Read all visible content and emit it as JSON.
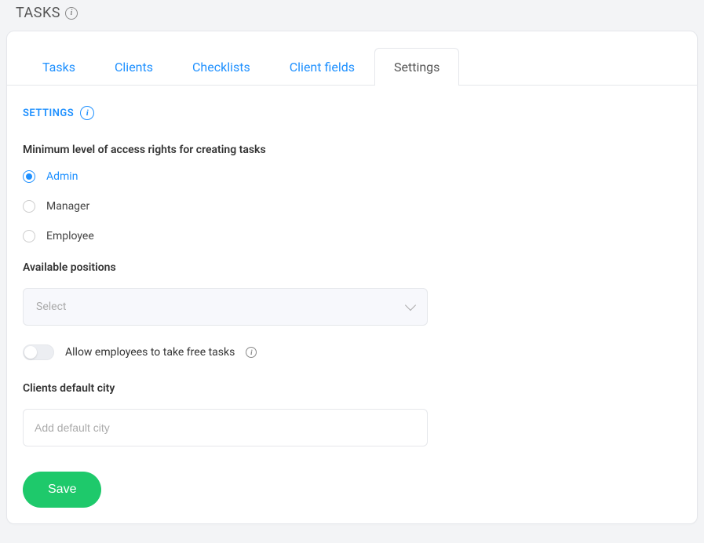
{
  "header": {
    "title": "TASKS"
  },
  "tabs": {
    "tasks": "Tasks",
    "clients": "Clients",
    "checklists": "Checklists",
    "client_fields": "Client fields",
    "settings": "Settings"
  },
  "section": {
    "title": "SETTINGS"
  },
  "access": {
    "label": "Minimum level of access rights for creating tasks",
    "options": {
      "admin": "Admin",
      "manager": "Manager",
      "employee": "Employee"
    }
  },
  "positions": {
    "label": "Available positions",
    "placeholder": "Select"
  },
  "toggle": {
    "label": "Allow employees to take free tasks"
  },
  "city": {
    "label": "Clients default city",
    "placeholder": "Add default city",
    "value": ""
  },
  "buttons": {
    "save": "Save"
  }
}
